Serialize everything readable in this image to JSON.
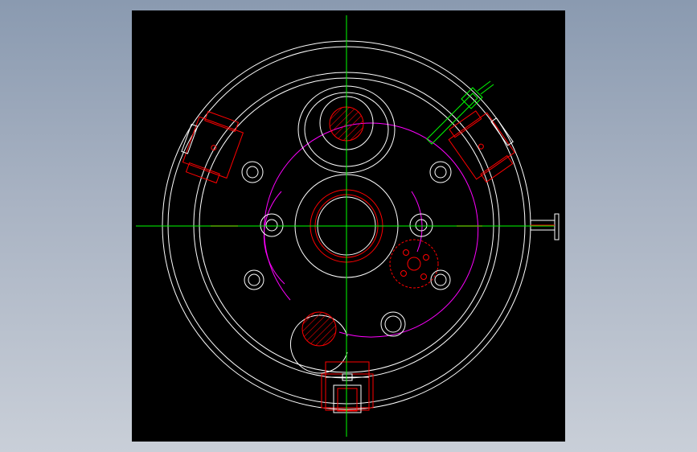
{
  "app": {
    "window_title": ""
  },
  "drawing": {
    "colors": {
      "background": "#000000",
      "outline": "#ffffff",
      "centerline": "#00ff00",
      "section": "#ff0000",
      "pitch_circle": "#ff00ff"
    },
    "layers": [
      "outline",
      "centerline",
      "section",
      "pitch_circle",
      "hatch"
    ]
  }
}
